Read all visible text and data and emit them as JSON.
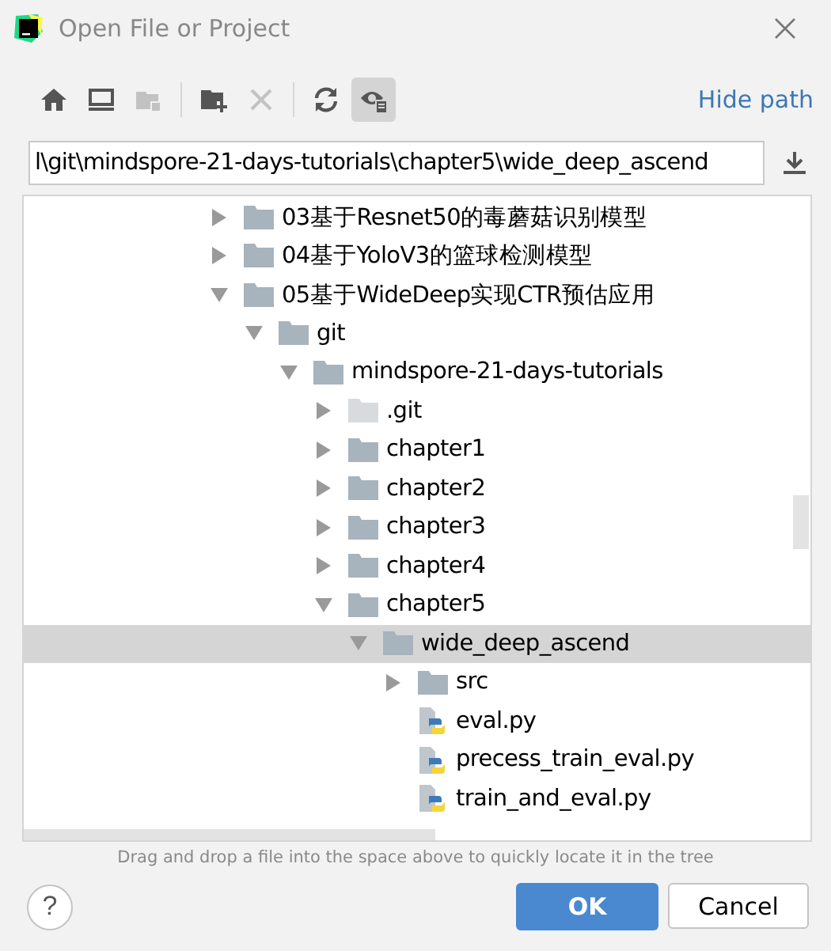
{
  "window": {
    "title": "Open File or Project"
  },
  "toolbar": [
    {
      "kind": "home",
      "disabled": false,
      "selected": false
    },
    {
      "kind": "desktop",
      "disabled": false,
      "selected": false
    },
    {
      "kind": "project-folder",
      "disabled": true,
      "selected": false
    },
    {
      "kind": "separator"
    },
    {
      "kind": "new-folder",
      "disabled": false,
      "selected": false
    },
    {
      "kind": "delete",
      "disabled": true,
      "selected": false
    },
    {
      "kind": "separator"
    },
    {
      "kind": "refresh",
      "disabled": false,
      "selected": false
    },
    {
      "kind": "show-hidden",
      "disabled": false,
      "selected": true
    }
  ],
  "hide_path_link": "Hide path",
  "path_field": {
    "value": "l\\git\\mindspore-21-days-tutorials\\chapter5\\wide_deep_ascend"
  },
  "tree": [
    {
      "label": "03基于Resnet50的毒蘑菇识别模型",
      "kind": "folder",
      "expanded": false,
      "selected": false
    },
    {
      "label": "04基于YoloV3的篮球检测模型",
      "kind": "folder",
      "expanded": false,
      "selected": false
    },
    {
      "label": "05基于WideDeep实现CTR预估应用",
      "kind": "folder",
      "expanded": true,
      "selected": false,
      "children": [
        {
          "label": "git",
          "kind": "folder",
          "expanded": true,
          "selected": false,
          "children": [
            {
              "label": "mindspore-21-days-tutorials",
              "kind": "folder",
              "expanded": true,
              "selected": false,
              "children": [
                {
                  "label": ".git",
                  "kind": "hidden-folder",
                  "expanded": false,
                  "selected": false
                },
                {
                  "label": "chapter1",
                  "kind": "folder",
                  "expanded": false,
                  "selected": false
                },
                {
                  "label": "chapter2",
                  "kind": "folder",
                  "expanded": false,
                  "selected": false
                },
                {
                  "label": "chapter3",
                  "kind": "folder",
                  "expanded": false,
                  "selected": false
                },
                {
                  "label": "chapter4",
                  "kind": "folder",
                  "expanded": false,
                  "selected": false
                },
                {
                  "label": "chapter5",
                  "kind": "folder",
                  "expanded": true,
                  "selected": false,
                  "children": [
                    {
                      "label": "wide_deep_ascend",
                      "kind": "folder",
                      "expanded": true,
                      "selected": true,
                      "children": [
                        {
                          "label": "src",
                          "kind": "folder",
                          "expanded": false,
                          "selected": false
                        },
                        {
                          "label": "eval.py",
                          "kind": "python-file",
                          "selected": false
                        },
                        {
                          "label": "precess_train_eval.py",
                          "kind": "python-file",
                          "selected": false
                        },
                        {
                          "label": "train_and_eval.py",
                          "kind": "python-file",
                          "selected": false
                        }
                      ]
                    }
                  ]
                }
              ]
            }
          ]
        }
      ]
    }
  ],
  "hint": "Drag and drop a file into the space above to quickly locate it in the tree",
  "buttons": {
    "help": "?",
    "ok": "OK",
    "cancel": "Cancel"
  }
}
